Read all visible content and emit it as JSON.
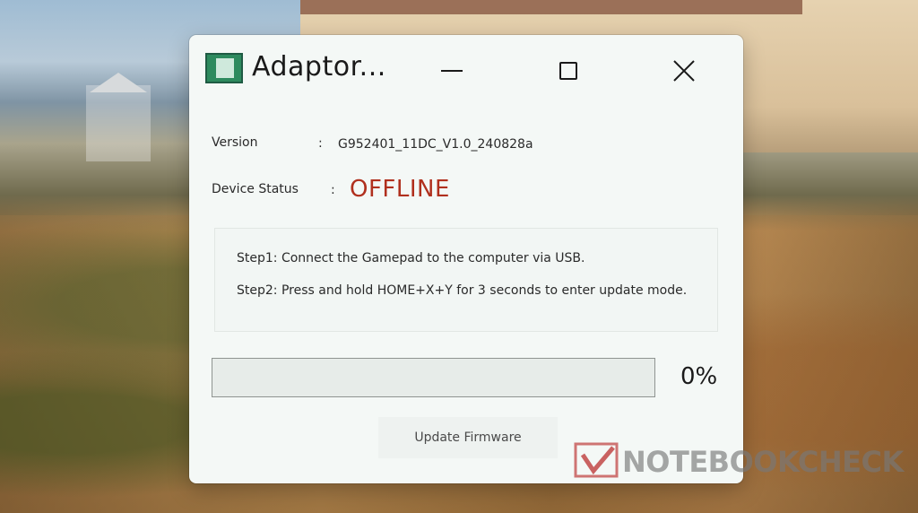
{
  "window": {
    "title": "Adaptor..."
  },
  "info": {
    "version_label": "Version",
    "version_colon": ":",
    "version_value": "G952401_11DC_V1.0_240828a",
    "status_label": "Device Status",
    "status_colon": ":",
    "status_value": "OFFLINE"
  },
  "steps": [
    "Step1: Connect the Gamepad to the computer via USB.",
    "Step2: Press and hold HOME+X+Y for 3 seconds to enter update mode."
  ],
  "progress": {
    "value": 0,
    "label": "0%"
  },
  "buttons": {
    "update_firmware": "Update Firmware"
  },
  "watermark": {
    "text": "NOTEBOOKCHECK"
  },
  "colors": {
    "status_offline": "#b0301e",
    "window_bg": "#f4f8f6"
  },
  "icons": {
    "app": "adaptor-app-icon",
    "minimize": "minimize-icon",
    "maximize": "maximize-icon",
    "close": "close-icon"
  }
}
